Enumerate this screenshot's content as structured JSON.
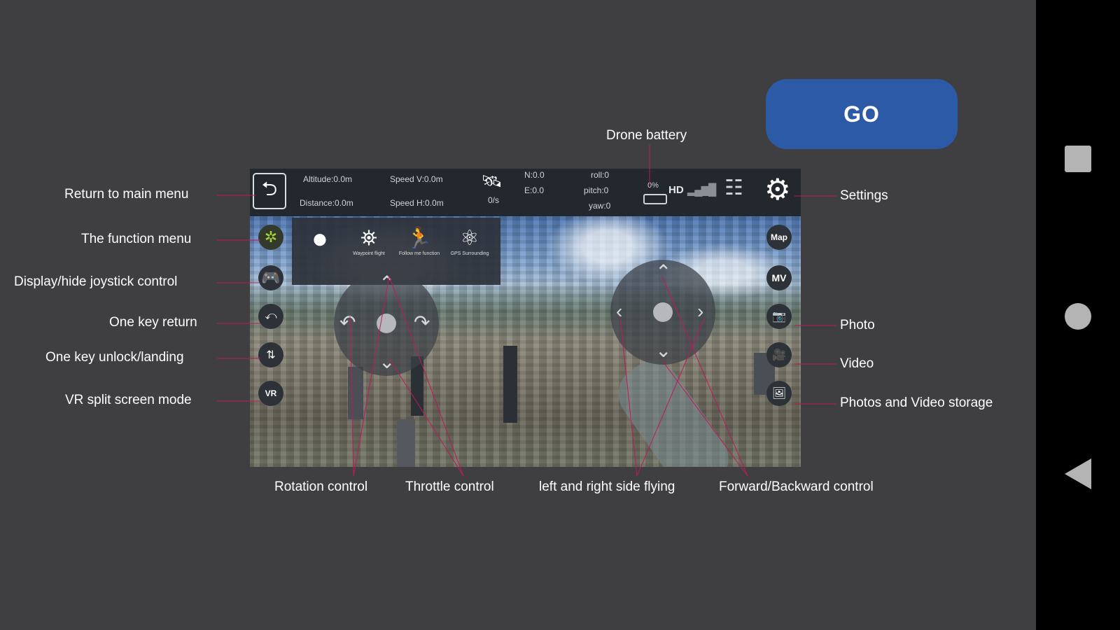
{
  "go_button": {
    "label": "GO"
  },
  "topbar": {
    "altitude": "Altitude:0.0m",
    "distance": "Distance:0.0m",
    "speed_v": "Speed V:0.0m",
    "speed_h": "Speed H:0.0m",
    "gps_count": "0/s",
    "north": "N:0.0",
    "east": "E:0.0",
    "roll": "roll:0",
    "pitch": "pitch:0",
    "yaw": "yaw:0",
    "battery": "0%",
    "hd": "HD"
  },
  "side_buttons": {
    "map": "Map",
    "mv": "MV",
    "vr": "VR"
  },
  "function_menu": [
    {
      "icon": "record-dot-icon",
      "caption": ""
    },
    {
      "icon": "waypoint-flight-icon",
      "caption": "Waypoint flight"
    },
    {
      "icon": "follow-me-icon",
      "caption": "Follow me function"
    },
    {
      "icon": "orbit-surrounding-icon",
      "caption": "GPS Surrounding"
    }
  ],
  "labels": {
    "drone_battery": "Drone battery",
    "return_main_menu": "Return to main menu",
    "function_menu": "The function menu",
    "joystick_toggle": "Display/hide joystick control",
    "one_key_return": "One key return",
    "one_key_unlock": "One key unlock/landing",
    "vr_mode": "VR split screen mode",
    "settings": "Settings",
    "photo": "Photo",
    "video": "Video",
    "storage": "Photos and Video storage",
    "rotation": "Rotation control",
    "throttle": "Throttle control",
    "side_flying": "left and right side flying",
    "forward_backward": "Forward/Backward control"
  },
  "colors": {
    "accent": "#2d5aa6",
    "leader_line": "#c2185b",
    "background": "#3f3f41"
  }
}
